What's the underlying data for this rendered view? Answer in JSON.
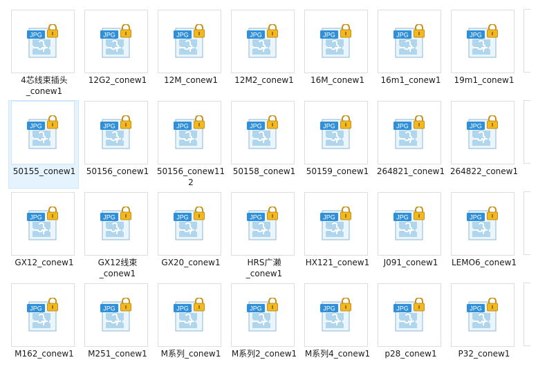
{
  "files": [
    {
      "name": "4芯线束插头\n_conew1",
      "type": "JPG",
      "selected": false
    },
    {
      "name": "12G2_conew1",
      "type": "JPG",
      "selected": false
    },
    {
      "name": "12M_conew1",
      "type": "JPG",
      "selected": false
    },
    {
      "name": "12M2_conew1",
      "type": "JPG",
      "selected": false
    },
    {
      "name": "16M_conew1",
      "type": "JPG",
      "selected": false
    },
    {
      "name": "16m1_conew1",
      "type": "JPG",
      "selected": false
    },
    {
      "name": "19m1_conew1",
      "type": "JPG",
      "selected": false
    },
    {
      "name": "50155_conew1",
      "type": "JPG",
      "selected": true
    },
    {
      "name": "50156_conew1",
      "type": "JPG",
      "selected": false
    },
    {
      "name": "50156_conew11\n2",
      "type": "JPG",
      "selected": false
    },
    {
      "name": "50158_conew1",
      "type": "JPG",
      "selected": false
    },
    {
      "name": "50159_conew1",
      "type": "JPG",
      "selected": false
    },
    {
      "name": "264821_conew1",
      "type": "JPG",
      "selected": false
    },
    {
      "name": "264822_conew1",
      "type": "JPG",
      "selected": false
    },
    {
      "name": "GX12_conew1",
      "type": "JPG",
      "selected": false
    },
    {
      "name": "GX12线束\n_conew1",
      "type": "JPG",
      "selected": false
    },
    {
      "name": "GX20_conew1",
      "type": "JPG",
      "selected": false
    },
    {
      "name": "HRS广濑\n_conew1",
      "type": "JPG",
      "selected": false
    },
    {
      "name": "HX121_conew1",
      "type": "JPG",
      "selected": false
    },
    {
      "name": "J091_conew1",
      "type": "JPG",
      "selected": false
    },
    {
      "name": "LEMO6_conew1",
      "type": "JPG",
      "selected": false
    },
    {
      "name": "M162_conew1",
      "type": "JPG",
      "selected": false
    },
    {
      "name": "M251_conew1",
      "type": "JPG",
      "selected": false
    },
    {
      "name": "M系列_conew1",
      "type": "JPG",
      "selected": false
    },
    {
      "name": "M系列2_conew1",
      "type": "JPG",
      "selected": false
    },
    {
      "name": "M系列4_conew1",
      "type": "JPG",
      "selected": false
    },
    {
      "name": "p28_conew1",
      "type": "JPG",
      "selected": false
    },
    {
      "name": "P32_conew1",
      "type": "JPG",
      "selected": false
    }
  ],
  "icon": "jpg-file-locked-icon",
  "colors": {
    "selection_bg": "#e5f3ff",
    "selection_border": "#cce8ff",
    "badge_blue": "#2f8fd8",
    "lock_gold": "#f2b81f"
  }
}
